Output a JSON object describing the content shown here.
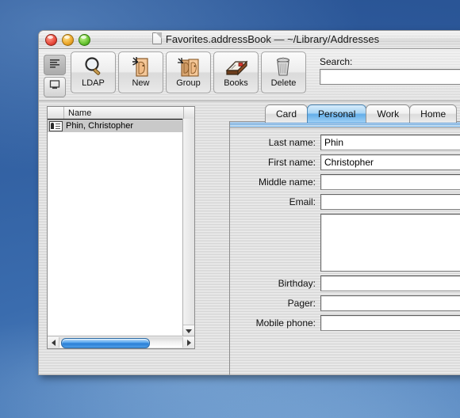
{
  "window": {
    "title": "Favorites.addressBook  —  ~/Library/Addresses",
    "title_icon": "document-icon",
    "controls": {
      "close": "close-button",
      "minimize": "minimize-button",
      "zoom": "zoom-button"
    }
  },
  "toolbar": {
    "view_toggle": [
      {
        "name": "list-view-toggle",
        "icon": "list-lines-icon",
        "selected": true
      },
      {
        "name": "card-view-toggle",
        "icon": "card-display-icon",
        "selected": false
      }
    ],
    "buttons": [
      {
        "label": "LDAP",
        "icon": "magnifying-glass-icon"
      },
      {
        "label": "New",
        "icon": "new-person-icon"
      },
      {
        "label": "Group",
        "icon": "group-people-icon"
      },
      {
        "label": "Books",
        "icon": "address-books-icon"
      },
      {
        "label": "Delete",
        "icon": "trash-can-icon"
      }
    ],
    "search": {
      "label": "Search:",
      "value": "",
      "placeholder": ""
    }
  },
  "list_pane": {
    "column_header": "Name",
    "rows": [
      {
        "label": "Phin, Christopher",
        "icon": "contact-card-icon",
        "selected": true
      }
    ],
    "scrollbars": {
      "horizontal": "horizontal-scrollbar",
      "vertical": "vertical-scrollbar"
    }
  },
  "tabs": [
    {
      "label": "Card",
      "active": false
    },
    {
      "label": "Personal",
      "active": true
    },
    {
      "label": "Work",
      "active": false
    },
    {
      "label": "Home",
      "active": false
    }
  ],
  "form": {
    "fields": [
      {
        "label": "Last name:",
        "value": "Phin",
        "type": "text"
      },
      {
        "label": "First name:",
        "value": "Christopher",
        "type": "text"
      },
      {
        "label": "Middle name:",
        "value": "",
        "type": "text"
      },
      {
        "label": "Email:",
        "value": "",
        "type": "text"
      },
      {
        "label": "",
        "value": "",
        "type": "textarea"
      },
      {
        "label": "Birthday:",
        "value": "",
        "type": "text"
      },
      {
        "label": "Pager:",
        "value": "",
        "type": "text"
      },
      {
        "label": "Mobile phone:",
        "value": "",
        "type": "text"
      }
    ]
  },
  "colors": {
    "accent": "#63aee9",
    "desktop": "#2d5ea4",
    "selection": "#c9c9c9",
    "panel_header": "#4f97dc"
  }
}
